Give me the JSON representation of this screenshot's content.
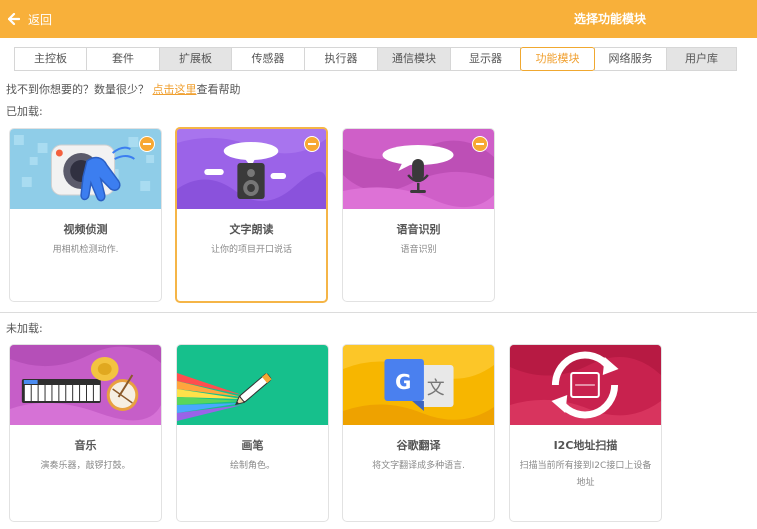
{
  "header": {
    "back_label": "返回",
    "title": "选择功能模块",
    "bar_color": "#f8b03a"
  },
  "tabs": [
    {
      "label": "主控板",
      "state": "normal"
    },
    {
      "label": "套件",
      "state": "normal"
    },
    {
      "label": "扩展板",
      "state": "gray"
    },
    {
      "label": "传感器",
      "state": "normal"
    },
    {
      "label": "执行器",
      "state": "normal"
    },
    {
      "label": "通信模块",
      "state": "gray"
    },
    {
      "label": "显示器",
      "state": "normal"
    },
    {
      "label": "功能模块",
      "state": "active"
    },
    {
      "label": "网络服务",
      "state": "normal"
    },
    {
      "label": "用户库",
      "state": "gray"
    }
  ],
  "help": {
    "prefix": "找不到你想要的？数量很少？",
    "link": "点击这里",
    "suffix": "查看帮助"
  },
  "loaded": {
    "label": "已加载:",
    "items": [
      {
        "title": "视频侦测",
        "desc": "用相机检测动作.",
        "icon": "camera-hand-icon"
      },
      {
        "title": "文字朗读",
        "desc": "让你的项目开口说话",
        "icon": "speaker-icon"
      },
      {
        "title": "语音识别",
        "desc": "语音识别",
        "icon": "microphone-icon"
      }
    ]
  },
  "unloaded": {
    "label": "未加载:",
    "items": [
      {
        "title": "音乐",
        "desc": "演奏乐器，敲锣打鼓。",
        "icon": "music-instruments-icon"
      },
      {
        "title": "画笔",
        "desc": "绘制角色。",
        "icon": "pen-icon"
      },
      {
        "title": "谷歌翻译",
        "desc": "将文字翻译成多种语言.",
        "icon": "google-translate-icon"
      },
      {
        "title": "I2C地址扫描",
        "desc": "扫描当前所有接到I2C接口上设备地址",
        "icon": "i2c-scan-icon"
      }
    ]
  },
  "colors": {
    "accent": "#f0a030",
    "selected_border": "#f5b547",
    "video_bg": "#8fcde8",
    "tts_bg": "#9b63e8",
    "speech_bg": "#cf5fc8",
    "music_bg": "#c65ec8",
    "pen_bg": "#16c08c",
    "translate_bg": "#f7b600",
    "i2c_bg": "#c8224e"
  }
}
